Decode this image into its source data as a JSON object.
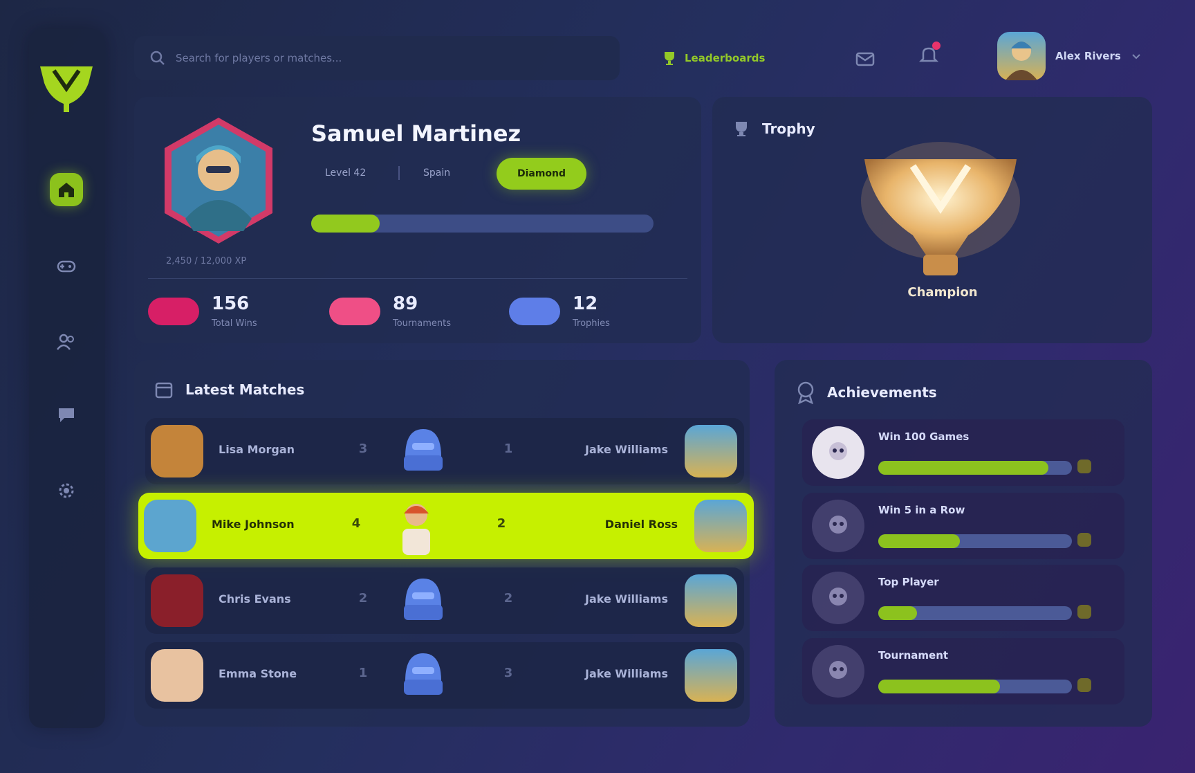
{
  "search": {
    "placeholder": "Search for players or matches..."
  },
  "top": {
    "link_label": "Leaderboards",
    "user_name": "Alex Rivers"
  },
  "colors": {
    "accent": "#93cc1c",
    "highlight": "#c6f000",
    "notification": "#e8336b",
    "background": "#242f5e"
  },
  "sidebar": {
    "items": [
      {
        "name": "home",
        "icon": "home-icon",
        "active": true
      },
      {
        "name": "games",
        "icon": "gamepad-icon",
        "active": false
      },
      {
        "name": "friends",
        "icon": "users-icon",
        "active": false
      },
      {
        "name": "chat",
        "icon": "chat-icon",
        "active": false
      },
      {
        "name": "settings",
        "icon": "gear-icon",
        "active": false
      }
    ]
  },
  "profile": {
    "name": "Samuel Martinez",
    "level_text": "Level 42",
    "country": "Spain",
    "rank": "Diamond",
    "xp_progress": 0.2,
    "xp_caption": "2,450 / 12,000 XP",
    "stats": [
      {
        "value": "156",
        "label": "Total Wins",
        "color": "#e2236a"
      },
      {
        "value": "89",
        "label": "Tournaments",
        "color": "#ef4f86"
      },
      {
        "value": "12",
        "label": "Trophies",
        "color": "#5e7ee8"
      }
    ]
  },
  "trophy_card": {
    "title": "Trophy",
    "award": "Champion"
  },
  "matches": {
    "title": "Latest Matches",
    "rows": [
      {
        "left": "Lisa Morgan",
        "left_score": "3",
        "right_score": "1",
        "right": "Jake Williams",
        "highlight": false
      },
      {
        "left": "Mike Johnson",
        "left_score": "4",
        "right_score": "2",
        "right": "Daniel Ross",
        "highlight": true
      },
      {
        "left": "Chris Evans",
        "left_score": "2",
        "right_score": "2",
        "right": "Jake Williams",
        "highlight": false
      },
      {
        "left": "Emma Stone",
        "left_score": "1",
        "right_score": "3",
        "right": "Jake Williams",
        "highlight": false
      }
    ]
  },
  "achievements": {
    "title": "Achievements",
    "items": [
      {
        "name": "Win 100 Games",
        "progress": 0.88
      },
      {
        "name": "Win 5 in a Row",
        "progress": 0.42
      },
      {
        "name": "Top Player",
        "progress": 0.2
      },
      {
        "name": "Tournament",
        "progress": 0.63
      }
    ]
  }
}
